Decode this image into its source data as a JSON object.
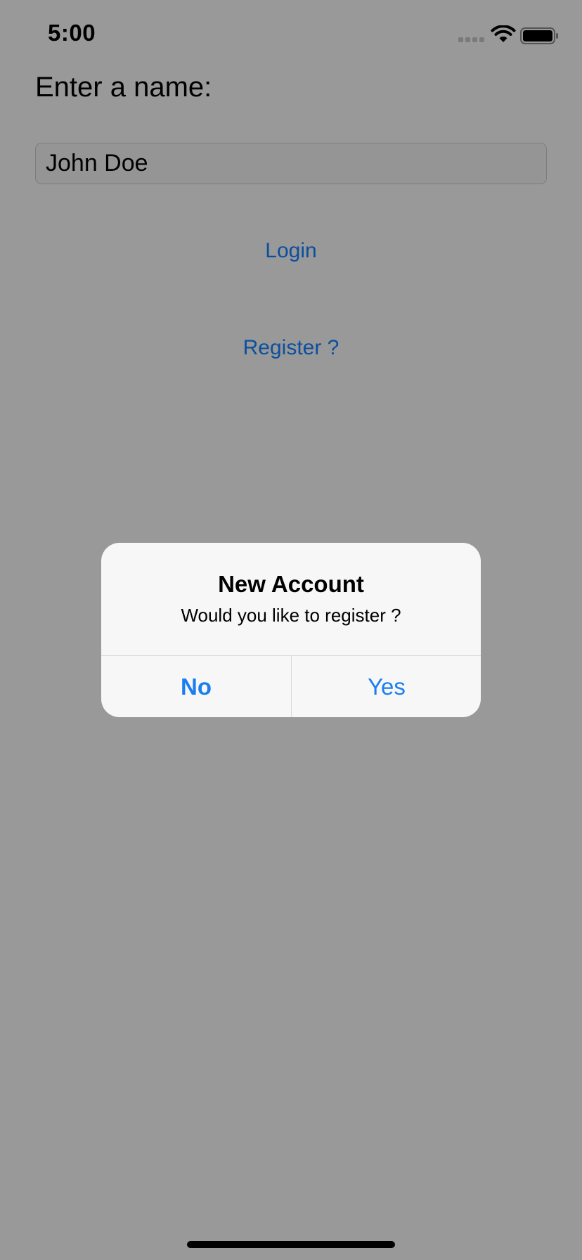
{
  "status_bar": {
    "time": "5:00",
    "signal_icon": "cellular-signal-icon",
    "wifi_icon": "wifi-icon",
    "battery_icon": "battery-icon"
  },
  "form": {
    "prompt": "Enter a name:",
    "name_value": "John Doe",
    "login_label": "Login",
    "register_label": "Register ?"
  },
  "alert": {
    "title": "New Account",
    "message": "Would you like to register ?",
    "no_label": "No",
    "yes_label": "Yes"
  },
  "colors": {
    "background_dimmed": "#999999",
    "link": "#0b4f9e",
    "alert_button": "#1a7ef2",
    "alert_background": "#f7f7f7"
  }
}
